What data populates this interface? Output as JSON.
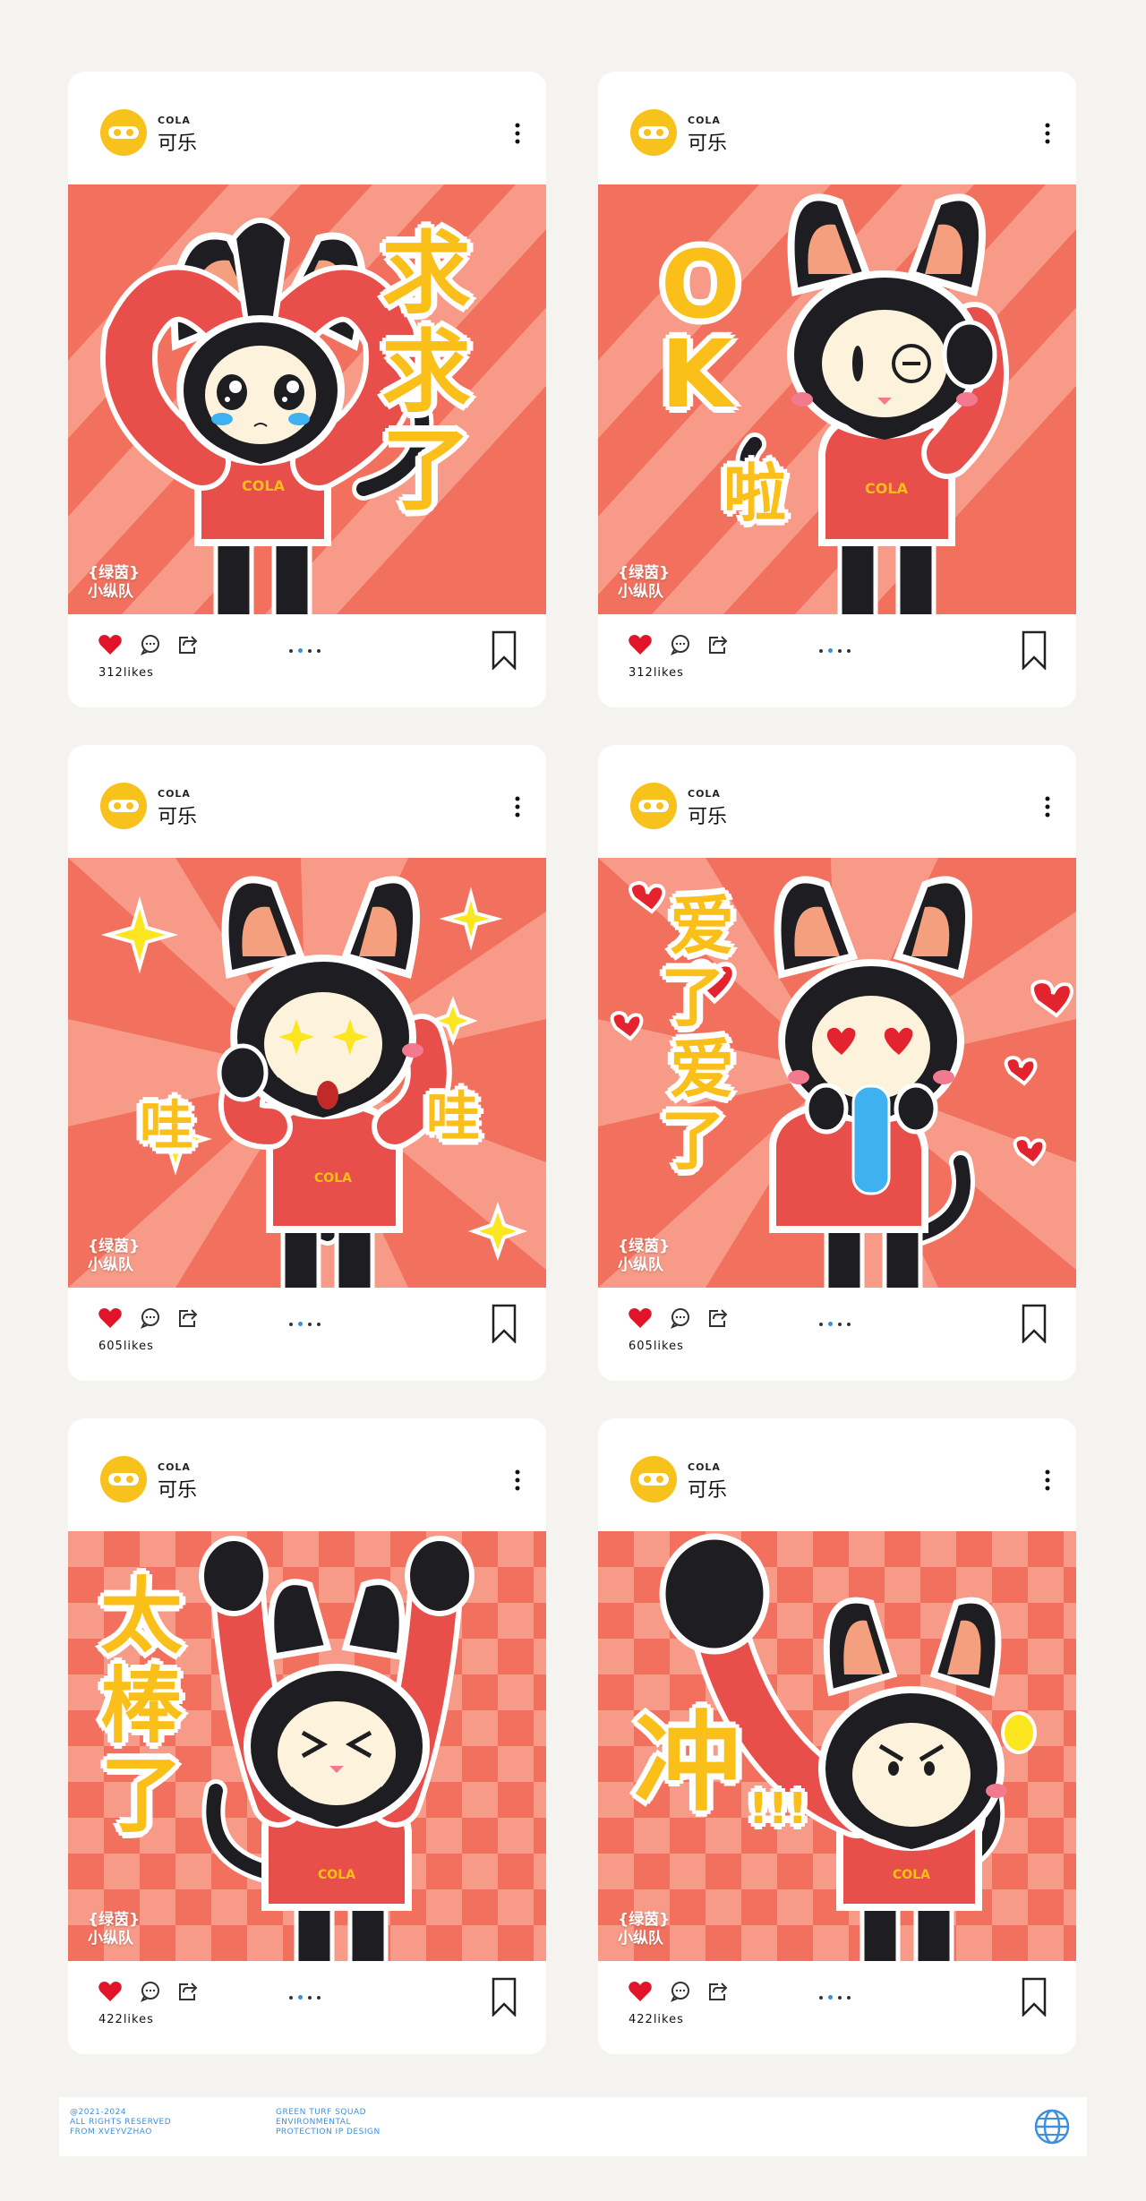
{
  "posts": [
    {
      "brand_small": "COLA",
      "brand_name": "可乐",
      "caption": [
        "求",
        "求",
        "了"
      ],
      "watermark": [
        "{绿茵}",
        "小纵队"
      ],
      "shirt": "COLA",
      "likes": "312likes"
    },
    {
      "brand_small": "COLA",
      "brand_name": "可乐",
      "caption": [
        "O",
        "K",
        "啦"
      ],
      "watermark": [
        "{绿茵}",
        "小纵队"
      ],
      "shirt": "COLA",
      "likes": "312likes"
    },
    {
      "brand_small": "COLA",
      "brand_name": "可乐",
      "caption": [
        "哇",
        "哇"
      ],
      "watermark": [
        "{绿茵}",
        "小纵队"
      ],
      "shirt": "COLA",
      "likes": "605likes"
    },
    {
      "brand_small": "COLA",
      "brand_name": "可乐",
      "caption": [
        "爱",
        "了",
        "爱",
        "了"
      ],
      "watermark": [
        "{绿茵}",
        "小纵队"
      ],
      "shirt": "COLA",
      "likes": "605likes"
    },
    {
      "brand_small": "COLA",
      "brand_name": "可乐",
      "caption": [
        "太",
        "棒",
        "了"
      ],
      "watermark": [
        "{绿茵}",
        "小纵队"
      ],
      "shirt": "COLA",
      "likes": "422likes"
    },
    {
      "brand_small": "COLA",
      "brand_name": "可乐",
      "caption": [
        "冲",
        "!!!"
      ],
      "watermark": [
        "{绿茵}",
        "小纵队"
      ],
      "shirt": "COLA",
      "likes": "422likes"
    }
  ],
  "footer": {
    "col1": [
      "@2021-2024",
      "ALL RIGHTS RESERVED",
      "FROM XVEYVZHAO"
    ],
    "col2": [
      "GREEN TURF SQUAD",
      "ENVIRONMENTAL",
      "PROTECTION IP DESIGN"
    ]
  },
  "colors": {
    "background": "#f4f3ef",
    "card": "#ffffff",
    "avatar": "#f6c21b",
    "caption": "#fbbf1a",
    "art_base": "#f2715e",
    "art_light": "#f79a88",
    "hoodie": "#e94f4a",
    "like_heart": "#e3142a",
    "footer_text": "#3d8fe0"
  },
  "icons": [
    "more-icon",
    "heart-icon",
    "comment-icon",
    "share-icon",
    "bookmark-icon",
    "globe-icon"
  ]
}
